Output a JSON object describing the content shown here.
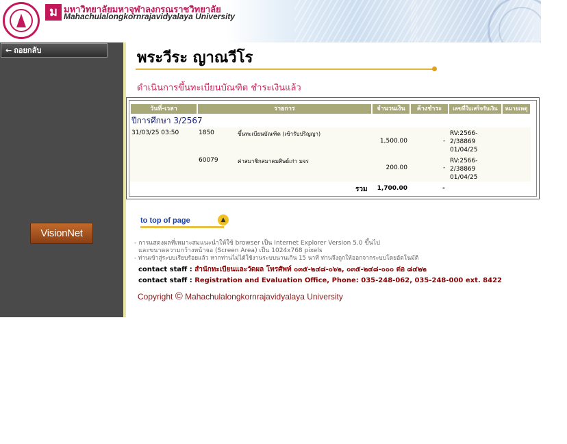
{
  "header": {
    "university_thai": "มหาวิทยาลัยมหาจุฬาลงกรณราชวิทยาลัย",
    "university_en": "Mahachulalongkornrajavidyalaya University"
  },
  "sidebar": {
    "back_label": "ถอยกลับ",
    "visionnet_label": "VisionNet"
  },
  "main": {
    "student_name": "พระวีระ ญาณวีโร",
    "subtitle": "ดำเนินการขึ้นทะเบียนบัณฑิต ชำระเงินแล้ว",
    "table": {
      "headers": [
        "วันที่-เวลา",
        "รายการ",
        "จำนวนเงิน",
        "ค้างชำระ",
        "เลขที่ใบเสร็จรับเงิน",
        "หมายเหตุ"
      ],
      "academic_year": "ปีการศึกษา 3/2567",
      "rows": [
        {
          "datetime": "31/03/25 03:50",
          "code": "1850",
          "description": "ขึ้นทะเบียนบัณฑิต (เข้ารับปริญญา)",
          "amount": "1,500.00",
          "due": "-",
          "receipt_line1": "RV:2566-",
          "receipt_line2": "2/38869",
          "receipt_line3": "01/04/25"
        },
        {
          "datetime": "",
          "code": "60079",
          "description": "ค่าสมาชิกสมาคมศิษย์เก่า มจร",
          "amount": "200.00",
          "due": "-",
          "receipt_line1": "RV:2566-",
          "receipt_line2": "2/38869",
          "receipt_line3": "01/04/25"
        }
      ],
      "total_label": "รวม",
      "total_amount": "1,700.00",
      "total_due": "-"
    },
    "to_top_label": "to top of page",
    "to_top_icon": "▲",
    "notes": {
      "line1": "- การแสดงผลที่เหมาะสมแนะนำให้ใช้ browser เป็น Internet Explorer Version 5.0 ขึ้นไป",
      "line2": "และขนาดความกว้างหน้าจอ (Screen Area) เป็น 1024x768 pixels",
      "line3": "- ท่านเข้าสู่ระบบเรียบร้อยแล้ว หากท่านไม่ได้ใช้งานระบบนานเกิน 15 นาที ท่านจึงถูกให้ออกจากระบบโดยอัตโนมัติ"
    },
    "contact1_label": "contact staff :",
    "contact1_value": "สำนักทะเบียนและวัดผล โทรศัพท์ ๐๓๕-๒๔๘-๐๖๒, ๐๓๕-๒๔๘-๐๐๐ ต่อ ๘๔๒๒",
    "contact2_label": "contact staff :",
    "contact2_value": "Registration and Evaluation Office, Phone: 035-248-062, 035-248-000 ext. 8422",
    "copyright_word": "Copyright",
    "copyright_symbol": "©",
    "copyright_owner": "Mahachulalongkornrajavidyalaya University"
  }
}
